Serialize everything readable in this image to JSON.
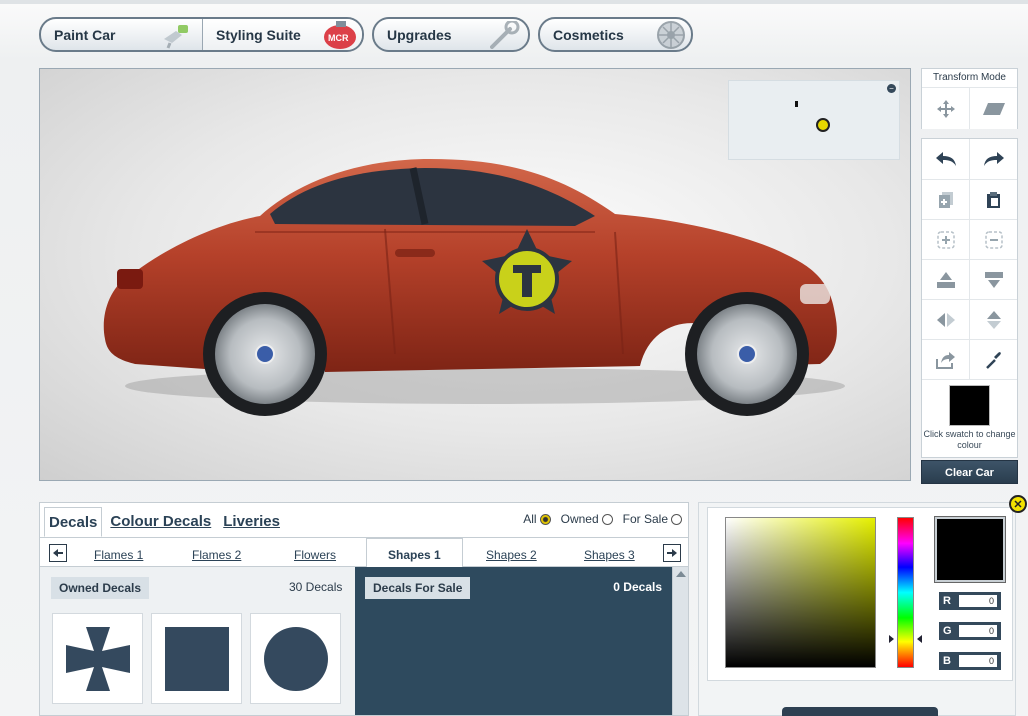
{
  "top_tabs": {
    "paint_car": "Paint Car",
    "styling_suite": "Styling Suite",
    "upgrades": "Upgrades",
    "cosmetics": "Cosmetics"
  },
  "toolbar": {
    "transform_mode_title": "Transform Mode",
    "swatch_label": "Click swatch to change colour",
    "swatch_color": "#000000",
    "clear_car": "Clear Car"
  },
  "decals": {
    "tabs": [
      "Decals",
      "Colour Decals",
      "Liveries"
    ],
    "active_tab": "Decals",
    "filters": {
      "all": "All",
      "owned": "Owned",
      "for_sale": "For Sale",
      "selected": "All"
    },
    "categories": [
      "Flames 1",
      "Flames 2",
      "Flowers",
      "Shapes 1",
      "Shapes 2",
      "Shapes 3"
    ],
    "active_category": "Shapes 1",
    "owned": {
      "label": "Owned Decals",
      "count": "30 Decals",
      "thumbnails": [
        "cross-shape-icon",
        "square-shape-icon",
        "circle-shape-icon"
      ]
    },
    "for_sale": {
      "label": "Decals For Sale",
      "count": "0 Decals"
    }
  },
  "color_picker": {
    "hue_color": "#e5f000",
    "preview_color": "#000000",
    "r_label": "R",
    "r_value": "0",
    "g_label": "G",
    "g_value": "0",
    "b_label": "B",
    "b_value": "0"
  },
  "colors": {
    "car_body": "#b5412a",
    "accent_dark": "#2e4a5e",
    "decal_shape": "#34495e",
    "highlight_yellow": "#e5e000"
  }
}
